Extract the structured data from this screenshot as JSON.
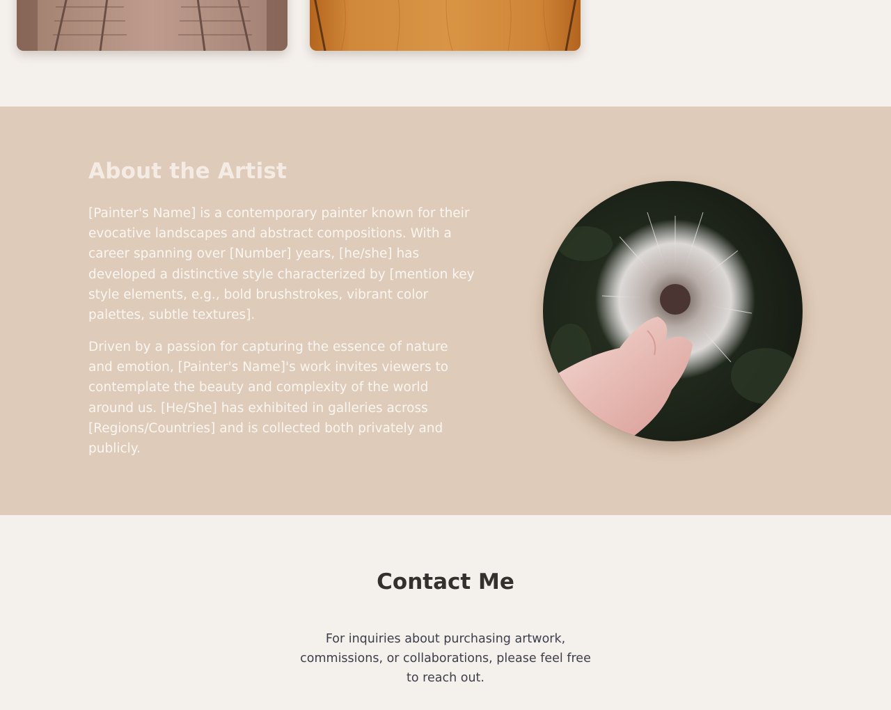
{
  "gallery": {
    "cards": [
      {
        "subject": "railway-tracks-image"
      },
      {
        "subject": "wood-panel-image"
      }
    ]
  },
  "about": {
    "title": "About the Artist",
    "paragraphs": [
      "[Painter's Name] is a contemporary painter known for their evocative landscapes and abstract compositions. With a career spanning over [Number] years, [he/she] has developed a distinctive style characterized by [mention key style elements, e.g., bold brushstrokes, vibrant color palettes, subtle textures].",
      "Driven by a passion for capturing the essence of nature and emotion, [Painter's Name]'s work invites viewers to contemplate the beauty and complexity of the world around us. [He/She] has exhibited in galleries across [Regions/Countries] and is collected both privately and publicly."
    ],
    "portrait": {
      "subject": "dandelion-in-hand-image"
    }
  },
  "contact": {
    "title": "Contact Me",
    "text": "For inquiries about purchasing artwork, commissions, or collaborations, please feel free to reach out."
  },
  "colors": {
    "page_background": "#f4f0ec",
    "about_background": "#dfcbb9",
    "heading_dark": "#33302e",
    "body_text_dark": "#3c3f4a",
    "about_text_light": "#fbf6f1"
  }
}
